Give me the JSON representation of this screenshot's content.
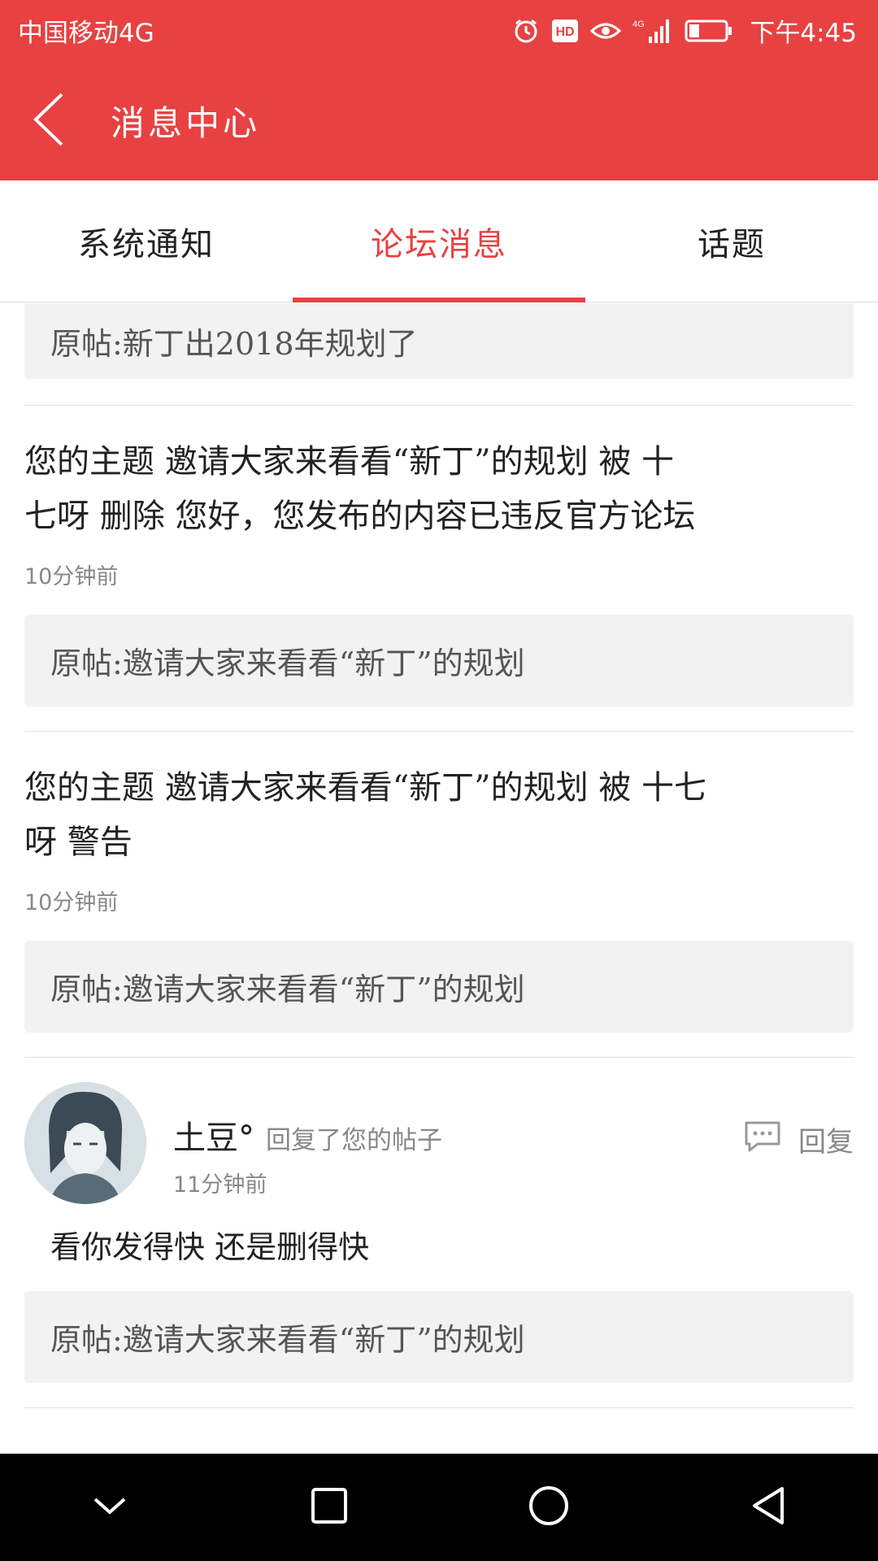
{
  "status_bar": {
    "carrier": "中国移动4G",
    "time": "下午4:45",
    "icons": [
      "alarm-icon",
      "hd-icon",
      "eye-icon",
      "signal-icon",
      "battery-icon"
    ]
  },
  "header": {
    "title": "消息中心",
    "back_icon": "back-arrow-icon",
    "color": "#e84142"
  },
  "tabs": [
    {
      "label": "系统通知",
      "active": false
    },
    {
      "label": "论坛消息",
      "active": true
    },
    {
      "label": "话题",
      "active": false
    }
  ],
  "feed": {
    "top_quote": "原帖:新丁出2018年规划了",
    "items": [
      {
        "text_line1": "您的主题 邀请大家来看看“新丁”的规划 被 十",
        "text_line2": "七呀 删除 您好，您发布的内容已违反官方论坛",
        "time": "10分钟前",
        "quote": "原帖:邀请大家来看看“新丁”的规划"
      },
      {
        "text_line1": "您的主题 邀请大家来看看“新丁”的规划 被 十七",
        "text_line2": "呀 警告",
        "time": "10分钟前",
        "quote": "原帖:邀请大家来看看“新丁”的规划"
      }
    ],
    "reply": {
      "user": "土豆°",
      "action": "回复了您的帖子",
      "time": "11分钟前",
      "reply_label": "回复",
      "body": "看你发得快 还是删得快",
      "quote": "原帖:邀请大家来看看“新丁”的规划"
    }
  },
  "nav_bar": {
    "buttons": [
      "hide-keyboard-icon",
      "recents-icon",
      "home-icon",
      "back-icon"
    ]
  }
}
